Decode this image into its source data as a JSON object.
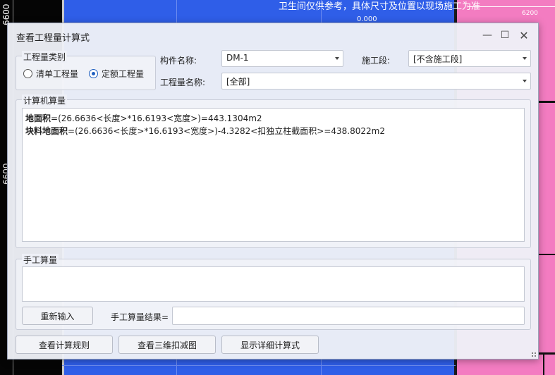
{
  "background": {
    "cad_note": "卫生间仅供参考，具体尺寸及位置以现场施工为准",
    "dim_right": "6200",
    "dim_top": "0.000",
    "dim_left": "6600",
    "colors": {
      "left": "#050505",
      "center": "#2f5ee8",
      "right": "#f37cc1"
    }
  },
  "dialog": {
    "title": "查看工程量计算式",
    "window_controls": {
      "minimize": "—",
      "maximize": "☐",
      "close": "✕"
    },
    "category_group": {
      "legend": "工程量类别",
      "options": [
        {
          "label": "清单工程量",
          "checked": false
        },
        {
          "label": "定额工程量",
          "checked": true
        }
      ]
    },
    "component_name": {
      "label": "构件名称:",
      "value": "DM-1"
    },
    "construction_stage": {
      "label": "施工段:",
      "value": "[不含施工段]"
    },
    "quantity_name": {
      "label": "工程量名称:",
      "value": "[全部]"
    },
    "computer_calc": {
      "legend": "计算机算量",
      "lines": [
        {
          "name": "地面积",
          "formula": "=(26.6636<长度>*16.6193<宽度>)=443.1304m2"
        },
        {
          "name": "块料地面积",
          "formula": "=(26.6636<长度>*16.6193<宽度>)-4.3282<扣独立柱截面积>=438.8022m2"
        }
      ]
    },
    "manual_calc": {
      "legend": "手工算量",
      "reenter_button": "重新输入",
      "result_label": "手工算量结果=",
      "result_value": ""
    },
    "buttons": {
      "view_rules": "查看计算规则",
      "view_3d": "查看三维扣减图",
      "show_detail": "显示详细计算式"
    }
  }
}
